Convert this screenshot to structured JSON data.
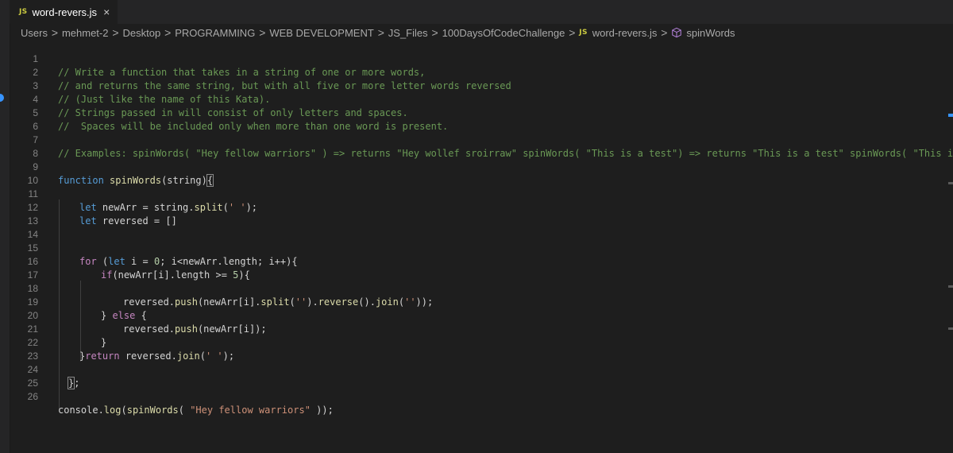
{
  "tab": {
    "lang_badge": "JS",
    "title": "word-revers.js",
    "close_icon": "×"
  },
  "breadcrumb": {
    "items": [
      "Users",
      "mehmet-2",
      "Desktop",
      "PROGRAMMING",
      "WEB DEVELOPMENT",
      "JS_Files",
      "100DaysOfCodeChallenge"
    ],
    "file_badge": "JS",
    "file": "word-revers.js",
    "symbol": "spinWords",
    "separator": ">"
  },
  "editor": {
    "line_numbers": [
      "1",
      "2",
      "3",
      "4",
      "5",
      "6",
      "7",
      "8",
      "9",
      "10",
      "11",
      "12",
      "13",
      "14",
      "15",
      "16",
      "17",
      "18",
      "19",
      "20",
      "21",
      "22",
      "23",
      "24",
      "25",
      "26"
    ],
    "lines": {
      "l1": "// Write a function that takes in a string of one or more words,",
      "l2": "// and returns the same string, but with all five or more letter words reversed",
      "l3": "// (Just like the name of this Kata).",
      "l4": "// Strings passed in will consist of only letters and spaces.",
      "l5": "//  Spaces will be included only when more than one word is present.",
      "l7": "// Examples: spinWords( \"Hey fellow warriors\" ) => returns \"Hey wollef sroirraw\" spinWords( \"This is a test\") => returns \"This is a test\" spinWords( \"This is another",
      "l9_kw": "function",
      "l9_fn": "spinWords",
      "l9_rest": "(string)",
      "l9_brace": "{",
      "l11_kw": "let",
      "l11_rest1": " newArr = string.",
      "l11_fn": "split",
      "l11_rest2": "(",
      "l11_str": "' '",
      "l11_rest3": ");",
      "l12_kw": "let",
      "l12_rest": " reversed = []",
      "l15_kw": "for",
      "l15_a": " (",
      "l15_kw2": "let",
      "l15_b": " i = ",
      "l15_num": "0",
      "l15_c": "; i<newArr.length; i++){",
      "l16_kw": "if",
      "l16_a": "(newArr[i].length >= ",
      "l16_num": "5",
      "l16_b": "){",
      "l18_a": "reversed.",
      "l18_fn1": "push",
      "l18_b": "(newArr[i].",
      "l18_fn2": "split",
      "l18_c": "(",
      "l18_s1": "''",
      "l18_d": ").",
      "l18_fn3": "reverse",
      "l18_e": "().",
      "l18_fn4": "join",
      "l18_f": "(",
      "l18_s2": "''",
      "l18_g": "));",
      "l19_a": "} ",
      "l19_kw": "else",
      "l19_b": " {",
      "l20_a": "reversed.",
      "l20_fn": "push",
      "l20_b": "(newArr[i]);",
      "l21": "}",
      "l22_a": "}",
      "l22_kw": "return",
      "l22_b": " reversed.",
      "l22_fn": "join",
      "l22_c": "(",
      "l22_str": "' '",
      "l22_d": ");",
      "l24_brace": "}",
      "l24_rest": ";",
      "l26_a": "console.",
      "l26_fn1": "log",
      "l26_b": "(",
      "l26_fn2": "spinWords",
      "l26_c": "( ",
      "l26_str": "\"Hey fellow warriors\"",
      "l26_d": " ));"
    }
  },
  "colors": {
    "background": "#1e1e1e",
    "comment": "#6a9955",
    "keyword": "#569cd6",
    "control": "#c586c0",
    "function": "#dcdcaa",
    "string": "#ce9178",
    "number": "#b5cea8",
    "accent": "#3794ff"
  }
}
